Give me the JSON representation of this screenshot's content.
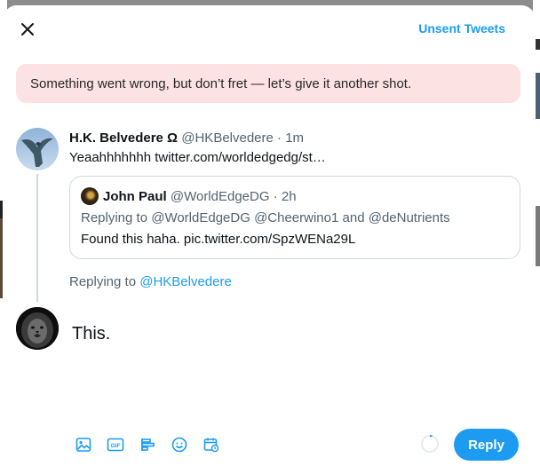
{
  "header": {
    "unsent_label": "Unsent Tweets"
  },
  "error_banner": {
    "text": "Something went wrong, but don’t fret — let’s give it another shot."
  },
  "original_tweet": {
    "name": "H.K. Belvedere Ω",
    "handle": "@HKBelvedere",
    "separator": " · ",
    "time": "1m",
    "text": "Yeaahhhhhhh twitter.com/worldedgedg/st…"
  },
  "quoted_tweet": {
    "name": "John Paul",
    "handle": "@WorldEdgeDG",
    "separator": " · ",
    "time": "2h",
    "replying_prefix": "Replying to ",
    "mention1": "@WorldEdgeDG",
    "mention2": "@Cheerwino1",
    "and_word": " and ",
    "mention3": "@deNutrients",
    "text": "Found this haha. pic.twitter.com/SpzWENa29L"
  },
  "replying_to": {
    "prefix": "Replying to ",
    "handle": "@HKBelvedere"
  },
  "composer": {
    "text": "This."
  },
  "toolbar": {
    "icons": [
      "image-icon",
      "gif-icon",
      "poll-icon",
      "emoji-icon",
      "schedule-icon"
    ]
  },
  "reply_button": {
    "label": "Reply"
  },
  "colors": {
    "accent": "#1d9bf0",
    "error_bg": "#fde2e4",
    "text_primary": "#0f1419",
    "text_muted": "#536471"
  }
}
